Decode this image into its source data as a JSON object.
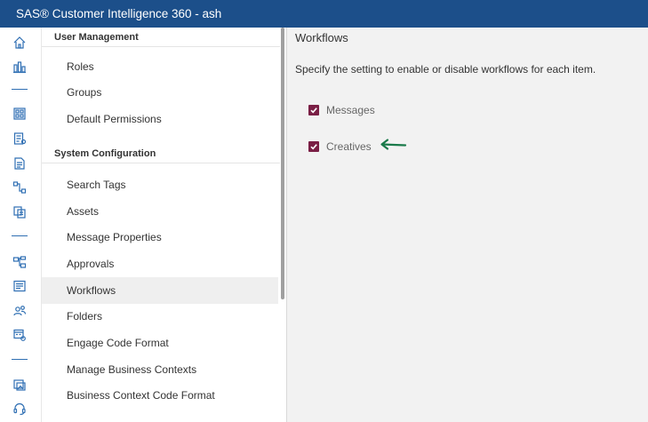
{
  "app": {
    "title": "SAS® Customer Intelligence 360 - ash"
  },
  "colors": {
    "titlebar": "#1c4f8a",
    "accent": "#2f6fb3",
    "checkbox": "#7a1f45",
    "arrow": "#1a7a4a"
  },
  "rail": {
    "icons": [
      "home-icon",
      "dashboard-chart-icon",
      "grid-icon",
      "document-list-icon",
      "document-icon",
      "flow-icon",
      "copy-pages-icon",
      "hierarchy-icon",
      "news-icon",
      "people-icon",
      "calendar-settings-icon",
      "image-gallery-icon",
      "headset-icon"
    ]
  },
  "nav": {
    "sections": [
      {
        "header": "User Management",
        "items": [
          "Roles",
          "Groups",
          "Default Permissions"
        ]
      },
      {
        "header": "System Configuration",
        "items": [
          "Search Tags",
          "Assets",
          "Message Properties",
          "Approvals",
          "Workflows",
          "Folders",
          "Engage Code Format",
          "Manage Business Contexts",
          "Business Context Code Format"
        ]
      }
    ],
    "selected": "Workflows"
  },
  "main": {
    "title": "Workflows",
    "description": "Specify the setting to enable or disable workflows for each item.",
    "options": [
      {
        "label": "Messages",
        "checked": true
      },
      {
        "label": "Creatives",
        "checked": true
      }
    ]
  }
}
